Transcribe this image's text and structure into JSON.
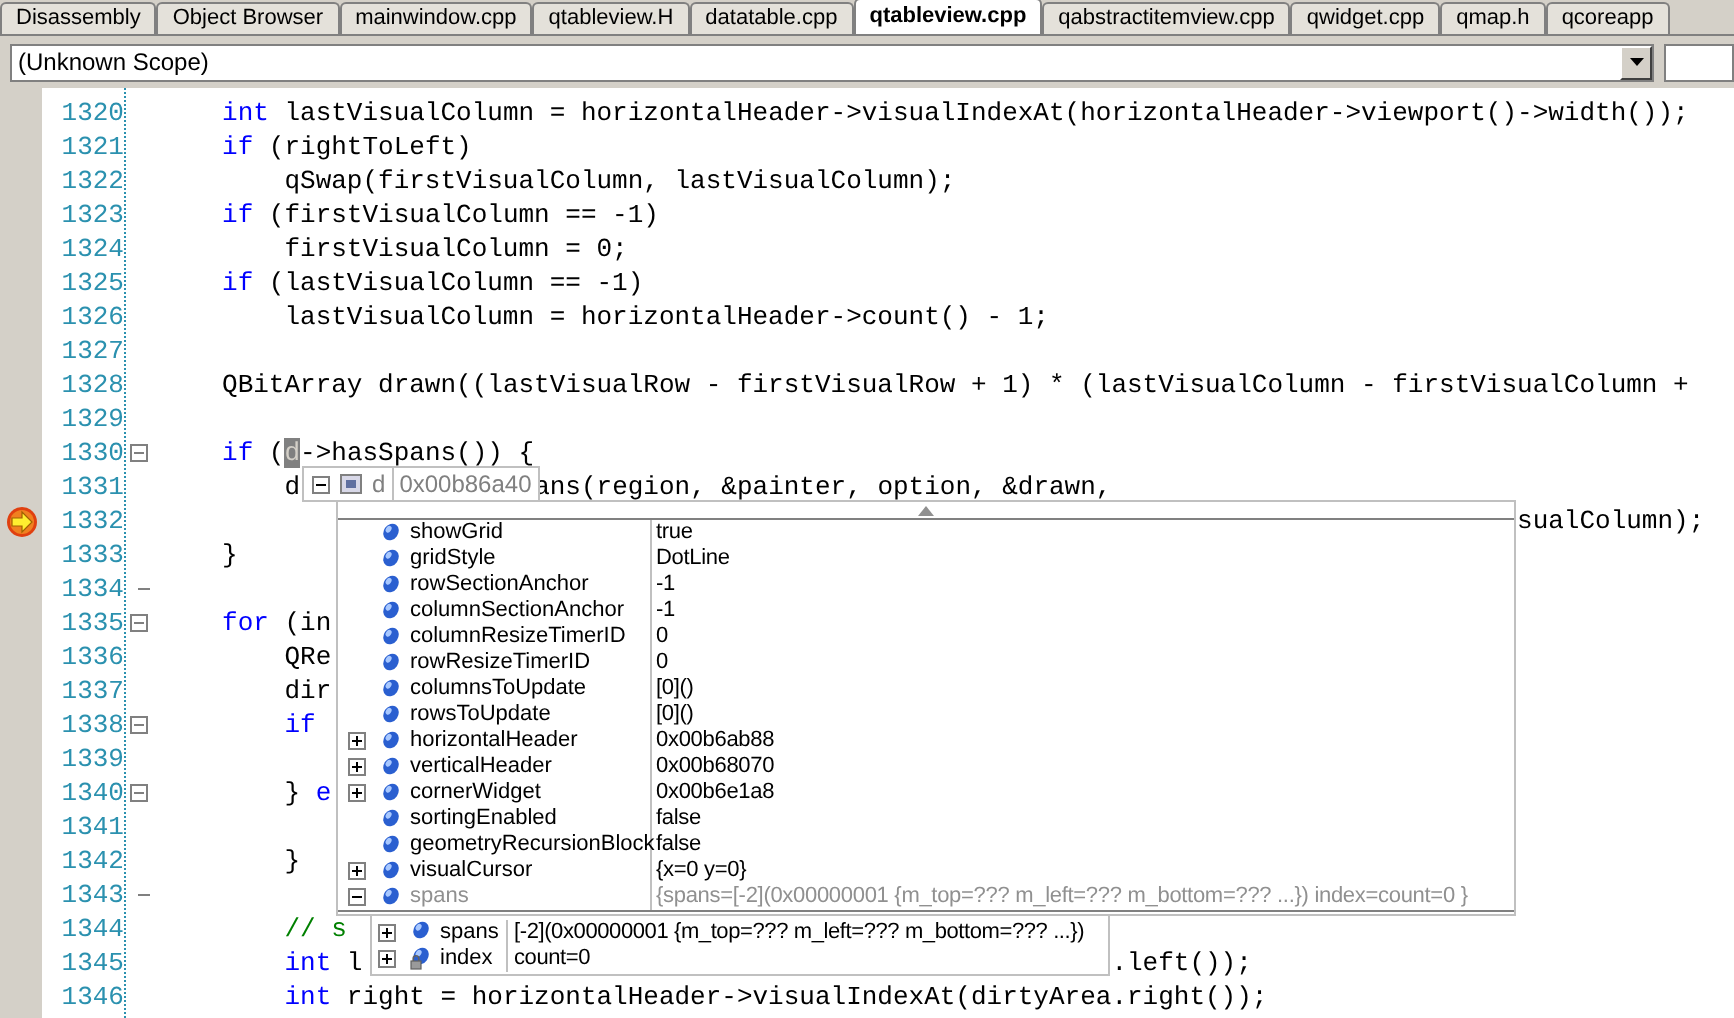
{
  "tabs": [
    {
      "label": "Disassembly",
      "selected": false
    },
    {
      "label": "Object Browser",
      "selected": false
    },
    {
      "label": "mainwindow.cpp",
      "selected": false
    },
    {
      "label": "qtableview.H",
      "selected": false
    },
    {
      "label": "datatable.cpp",
      "selected": false
    },
    {
      "label": "qtableview.cpp",
      "selected": true
    },
    {
      "label": "qabstractitemview.cpp",
      "selected": false
    },
    {
      "label": "qwidget.cpp",
      "selected": false
    },
    {
      "label": "qmap.h",
      "selected": false
    },
    {
      "label": "qcoreapp",
      "selected": false
    }
  ],
  "scope": {
    "value": "(Unknown Scope)"
  },
  "editor": {
    "lines": [
      {
        "number": "1320",
        "kind": "plain",
        "current": false,
        "segments": [
          {
            "tokens": [
              {
                "kind": "keyword",
                "text": "    int"
              },
              {
                "kind": "plain",
                "text": " lastVisualColumn = horizontalHeader->visualIndexAt(horizontalHeader->viewport()->width());"
              }
            ]
          }
        ]
      },
      {
        "number": "1321",
        "kind": "plain",
        "current": false,
        "segments": [
          {
            "tokens": [
              {
                "kind": "keyword",
                "text": "    if"
              },
              {
                "kind": "plain",
                "text": " (rightToLeft)"
              }
            ]
          }
        ]
      },
      {
        "number": "1322",
        "kind": "plain",
        "current": false,
        "segments": [
          {
            "tokens": [
              {
                "kind": "plain",
                "text": "        qSwap(firstVisualColumn, lastVisualColumn);"
              }
            ]
          }
        ]
      },
      {
        "number": "1323",
        "kind": "plain",
        "current": false,
        "segments": [
          {
            "tokens": [
              {
                "kind": "keyword",
                "text": "    if"
              },
              {
                "kind": "plain",
                "text": " (firstVisualColumn == -1)"
              }
            ]
          }
        ]
      },
      {
        "number": "1324",
        "kind": "plain",
        "current": false,
        "segments": [
          {
            "tokens": [
              {
                "kind": "plain",
                "text": "        firstVisualColumn = 0;"
              }
            ]
          }
        ]
      },
      {
        "number": "1325",
        "kind": "plain",
        "current": false,
        "segments": [
          {
            "tokens": [
              {
                "kind": "keyword",
                "text": "    if"
              },
              {
                "kind": "plain",
                "text": " (lastVisualColumn == -1)"
              }
            ]
          }
        ]
      },
      {
        "number": "1326",
        "kind": "plain",
        "current": false,
        "segments": [
          {
            "tokens": [
              {
                "kind": "plain",
                "text": "        lastVisualColumn = horizontalHeader->count() - 1;"
              }
            ]
          }
        ]
      },
      {
        "number": "1327",
        "kind": "plain",
        "current": false
      },
      {
        "number": "1328",
        "kind": "plain",
        "current": false,
        "segments": [
          {
            "tokens": [
              {
                "kind": "plain",
                "text": "    QBitArray drawn((lastVisualRow - firstVisualRow + 1) * (lastVisualColumn - firstVisualColumn +"
              }
            ]
          }
        ]
      },
      {
        "number": "1329",
        "kind": "plain",
        "current": false
      },
      {
        "number": "1330",
        "kind": "fold_start",
        "current": false,
        "segments": [
          {
            "tokens": [
              {
                "kind": "keyword",
                "text": "    if"
              },
              {
                "kind": "plain",
                "text": " ("
              },
              {
                "kind": "selection",
                "text": "d"
              },
              {
                "kind": "plain",
                "text": "->hasSpans()) {"
              }
            ]
          }
        ]
      },
      {
        "number": "1331",
        "kind": "plain",
        "current": false,
        "segments": [
          {
            "tokens": [
              {
                "kind": "plain",
                "text": "        d"
              }
            ]
          },
          {
            "tokens": [
              {
                "kind": "plain",
                "text": "               ans(region, &painter, option, &drawn,"
              }
            ]
          }
        ]
      },
      {
        "number": "1332",
        "kind": "plain",
        "current": true,
        "segments": [
          {
            "tokens": [
              {
                "kind": "plain",
                "text": "                                                                                       sualColumn);"
              }
            ]
          }
        ]
      },
      {
        "number": "1333",
        "kind": "plain",
        "current": false,
        "segments": [
          {
            "tokens": [
              {
                "kind": "plain",
                "text": "    }"
              }
            ]
          }
        ]
      },
      {
        "number": "1334",
        "kind": "fold_end",
        "current": false
      },
      {
        "number": "1335",
        "kind": "fold_start",
        "current": false,
        "segments": [
          {
            "tokens": [
              {
                "kind": "keyword",
                "text": "    for"
              },
              {
                "kind": "plain",
                "text": " (in"
              }
            ]
          }
        ]
      },
      {
        "number": "1336",
        "kind": "plain",
        "current": false,
        "segments": [
          {
            "tokens": [
              {
                "kind": "plain",
                "text": "        QRe"
              }
            ]
          }
        ]
      },
      {
        "number": "1337",
        "kind": "plain",
        "current": false,
        "segments": [
          {
            "tokens": [
              {
                "kind": "plain",
                "text": "        dir"
              }
            ]
          }
        ]
      },
      {
        "number": "1338",
        "kind": "fold_start",
        "current": false,
        "segments": [
          {
            "tokens": [
              {
                "kind": "keyword",
                "text": "        if"
              }
            ]
          }
        ]
      },
      {
        "number": "1339",
        "kind": "plain",
        "current": false
      },
      {
        "number": "1340",
        "kind": "fold_start",
        "current": false,
        "segments": [
          {
            "tokens": [
              {
                "kind": "plain",
                "text": "        } "
              },
              {
                "kind": "keyword",
                "text": "e"
              }
            ]
          }
        ]
      },
      {
        "number": "1341",
        "kind": "plain",
        "current": false
      },
      {
        "number": "1342",
        "kind": "plain",
        "current": false,
        "segments": [
          {
            "tokens": [
              {
                "kind": "plain",
                "text": "        }"
              }
            ]
          }
        ]
      },
      {
        "number": "1343",
        "kind": "fold_end",
        "current": false
      },
      {
        "number": "1344",
        "kind": "plain",
        "current": false,
        "segments": [
          {
            "tokens": [
              {
                "kind": "comment",
                "text": "        // s"
              }
            ]
          }
        ]
      },
      {
        "number": "1345",
        "kind": "plain",
        "current": false,
        "segments": [
          {
            "tokens": [
              {
                "kind": "keyword",
                "text": "        int"
              },
              {
                "kind": "plain",
                "text": " l"
              }
            ]
          },
          {
            "tokens": [
              {
                "kind": "plain",
                "text": "                                                .left());"
              }
            ]
          }
        ]
      },
      {
        "number": "1346",
        "kind": "plain",
        "current": false,
        "segments": [
          {
            "tokens": [
              {
                "kind": "keyword",
                "text": "        int"
              },
              {
                "kind": "plain",
                "text": " right = horizontalHeader->visualIndexAt(dirtyArea.right());"
              }
            ]
          }
        ]
      }
    ]
  },
  "datatip": {
    "name": "d",
    "value": "0x00b86a40",
    "expanded": true,
    "members": [
      {
        "name": "showGrid",
        "value": "true",
        "kind": "field",
        "expandable": false,
        "expanded": false
      },
      {
        "name": "gridStyle",
        "value": "DotLine",
        "kind": "field",
        "expandable": false,
        "expanded": false
      },
      {
        "name": "rowSectionAnchor",
        "value": "-1",
        "kind": "field",
        "expandable": false,
        "expanded": false
      },
      {
        "name": "columnSectionAnchor",
        "value": "-1",
        "kind": "field",
        "expandable": false,
        "expanded": false
      },
      {
        "name": "columnResizeTimerID",
        "value": "0",
        "kind": "field",
        "expandable": false,
        "expanded": false
      },
      {
        "name": "rowResizeTimerID",
        "value": "0",
        "kind": "field",
        "expandable": false,
        "expanded": false
      },
      {
        "name": "columnsToUpdate",
        "value": "[0]()",
        "kind": "field",
        "expandable": false,
        "expanded": false
      },
      {
        "name": "rowsToUpdate",
        "value": "[0]()",
        "kind": "field",
        "expandable": false,
        "expanded": false
      },
      {
        "name": "horizontalHeader",
        "value": "0x00b6ab88",
        "kind": "field",
        "expandable": true,
        "expanded": false
      },
      {
        "name": "verticalHeader",
        "value": "0x00b68070",
        "kind": "field",
        "expandable": true,
        "expanded": false
      },
      {
        "name": "cornerWidget",
        "value": "0x00b6e1a8",
        "kind": "field",
        "expandable": true,
        "expanded": false
      },
      {
        "name": "sortingEnabled",
        "value": "false",
        "kind": "field",
        "expandable": false,
        "expanded": false
      },
      {
        "name": "geometryRecursionBlock",
        "value": "false",
        "kind": "field",
        "expandable": false,
        "expanded": false
      },
      {
        "name": "visualCursor",
        "value": "{x=0 y=0}",
        "kind": "field",
        "expandable": true,
        "expanded": false
      },
      {
        "name": "spans",
        "value": "{spans=[-2](0x00000001 {m_top=??? m_left=??? m_bottom=??? ...}) index=count=0 }",
        "kind": "field",
        "expandable": true,
        "expanded": true
      }
    ],
    "child_tip": {
      "members": [
        {
          "name": "spans",
          "value": "[-2](0x00000001 {m_top=??? m_left=??? m_bottom=??? ...})",
          "kind": "field",
          "expandable": true,
          "expanded": false
        },
        {
          "name": "index",
          "value": "count=0",
          "kind": "locked",
          "expandable": true,
          "expanded": false
        }
      ]
    }
  }
}
